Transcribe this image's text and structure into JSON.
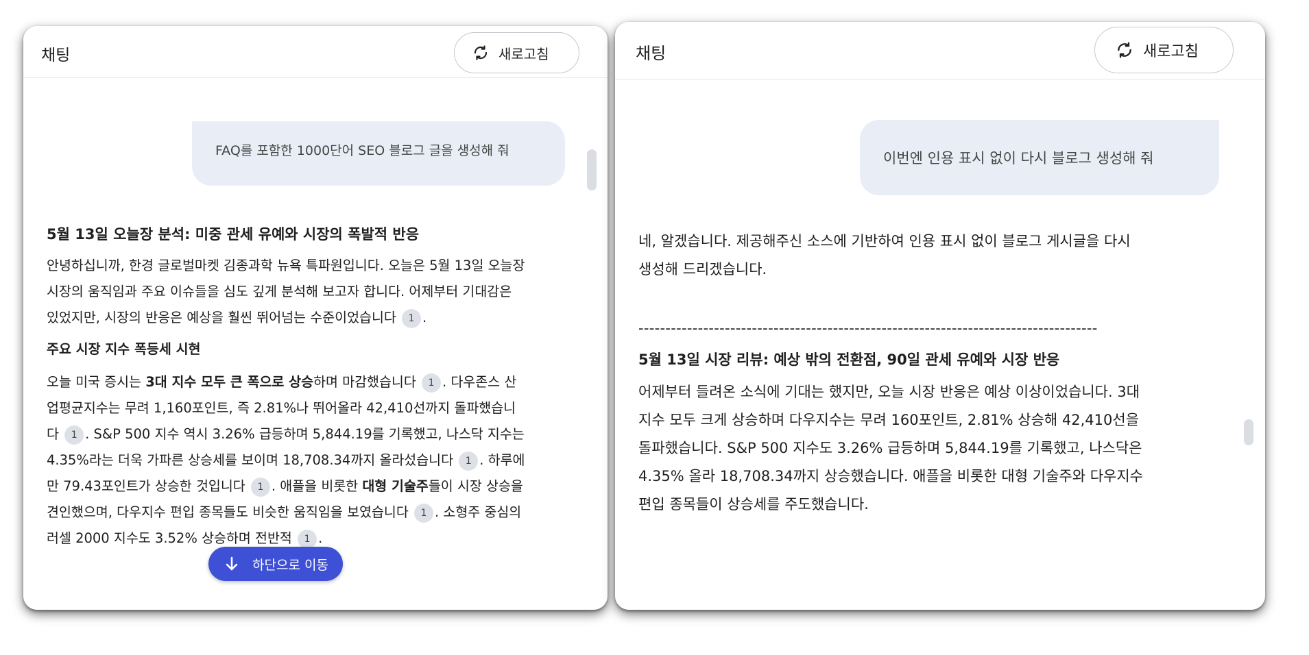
{
  "left": {
    "title": "채팅",
    "refresh_label": "새로고침",
    "user_message": "FAQ를 포함한 1000단어 SEO 블로그 글을 생성해 줘",
    "heading": "5월 13일 오늘장 분석: 미중 관세 유예와 시장의 폭발적 반응",
    "p1_a": "안녕하십니까, 한경 글로벌마켓 김종과학 뉴욕 특파원입니다. 오늘은 5월 13일 오늘장 시장의 움직임과 주요 이슈들을 심도 깊게 분석해 보고자 합니다. 어제부터 기대감은 있었지만, 시장의 반응은 예상을 훨씬 뛰어넘는 수준이었습니다",
    "subheading": "주요 시장 지수 폭등세 시현",
    "p2_a": "오늘 미국 증시는 ",
    "p2_b": "3대 지수 모두 큰 폭으로 상승",
    "p2_c": "하며 마감했습니다",
    "p2_d": ". 다우존스 산업평균지수는 무려 1,160포인트, 즉 2.81%나 뛰어올라 42,410선까지 돌파했습니다",
    "p2_e": ". S&P 500 지수 역시 3.26% 급등하며 5,844.19를 기록했고, 나스닥 지수는 4.35%라는 더욱 가파른 상승세를 보이며 18,708.34까지 올라섰습니다",
    "p2_f": ". 하루에만 79.43포인트가 상승한 것입니다",
    "p2_g": ". 애플을 비롯한 ",
    "p2_h": "대형 기술주",
    "p2_i": "들이 시장 상승을 견인했으며, 다우지수 편입 종목들도 비슷한 움직임을 보였습니다",
    "p2_j": ". 소형주 중심의 러셀 2000 지수도 3.52% 상승하며 전반적",
    "citation": "1",
    "scroll_down_label": "하단으로 이동"
  },
  "right": {
    "title": "채팅",
    "refresh_label": "새로고침",
    "user_message": "이번엔 인용 표시 없이 다시 블로그 생성해 줘",
    "intro": "네, 알겠습니다. 제공해주신 소스에 기반하여 인용 표시 없이 블로그 게시글을 다시 생성해 드리겠습니다.",
    "separator": "-------------------------------------------------------------------------------------",
    "heading": "5월 13일 시장 리뷰: 예상 밖의 전환점, 90일 관세 유예와 시장 반응",
    "body": "어제부터 들려온 소식에 기대는 했지만, 오늘 시장 반응은 예상 이상이었습니다. 3대 지수 모두 크게 상승하며 다우지수는 무려 160포인트, 2.81% 상승해 42,410선을 돌파했습니다. S&P 500 지수도 3.26% 급등하며 5,844.19를 기록했고, 나스닥은 4.35% 올라 18,708.34까지 상승했습니다. 애플을 비롯한 대형 기술주와 다우지수 편입 종목들이 상승세를 주도했습니다."
  },
  "icons": {
    "refresh": "refresh-icon",
    "arrow_down": "arrow-down-icon"
  },
  "colors": {
    "user_bubble": "#e9eef6",
    "scroll_button": "#3e51d6",
    "citation_chip": "#dde1e7"
  }
}
